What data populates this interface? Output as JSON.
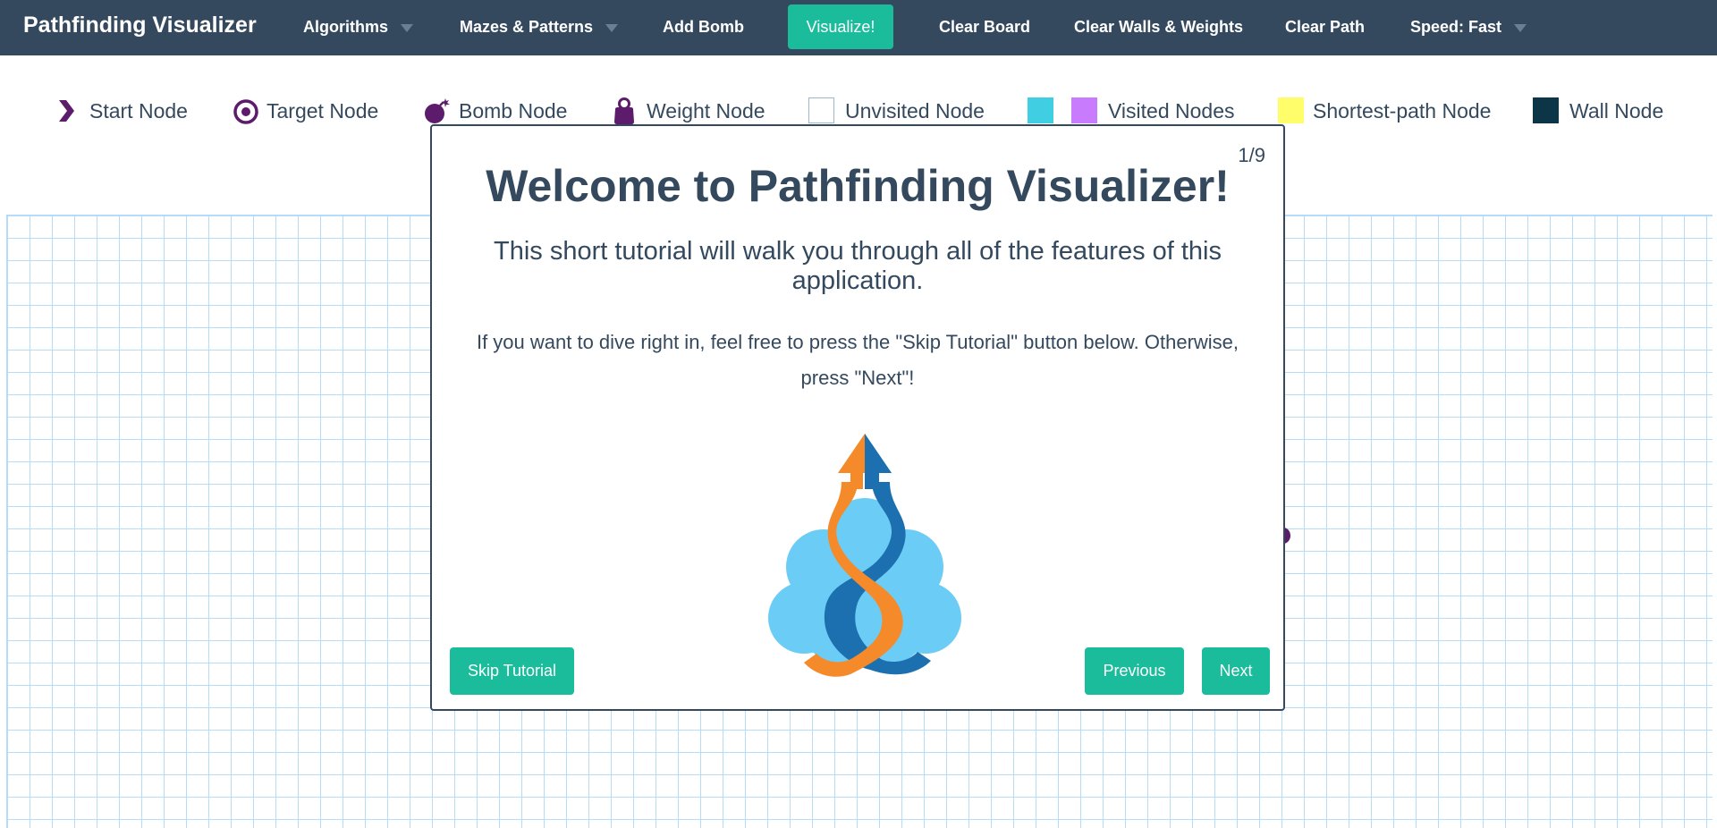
{
  "navbar": {
    "brand": "Pathfinding Visualizer",
    "items": {
      "algorithms": "Algorithms",
      "mazes": "Mazes & Patterns",
      "add_bomb": "Add Bomb",
      "visualize": "Visualize!",
      "clear_board": "Clear Board",
      "clear_walls": "Clear Walls & Weights",
      "clear_path": "Clear Path",
      "speed": "Speed: Fast"
    }
  },
  "legend": {
    "start": "Start Node",
    "target": "Target Node",
    "bomb": "Bomb Node",
    "weight": "Weight Node",
    "unvisited": "Unvisited Node",
    "visited": "Visited Nodes",
    "shortest": "Shortest-path Node",
    "wall": "Wall Node"
  },
  "modal": {
    "counter": "1/9",
    "title": "Welcome to Pathfinding Visualizer!",
    "subtitle": "This short tutorial will walk you through all of the features of this application.",
    "body": "If you want to dive right in, feel free to press the \"Skip Tutorial\" button below. Otherwise, press \"Next\"!",
    "skip": "Skip Tutorial",
    "previous": "Previous",
    "next": "Next"
  },
  "colors": {
    "navbar": "#34495e",
    "accent": "#1abc9c",
    "visited_a": "#40cee3",
    "visited_b": "#c87bfc",
    "shortest": "#fffe6a",
    "wall": "#0c3547",
    "node_purple": "#5d1c6b"
  },
  "icons": [
    "chevron-right-icon",
    "target-icon",
    "bomb-icon",
    "weight-icon",
    "caret-down-icon",
    "logo-icon"
  ]
}
